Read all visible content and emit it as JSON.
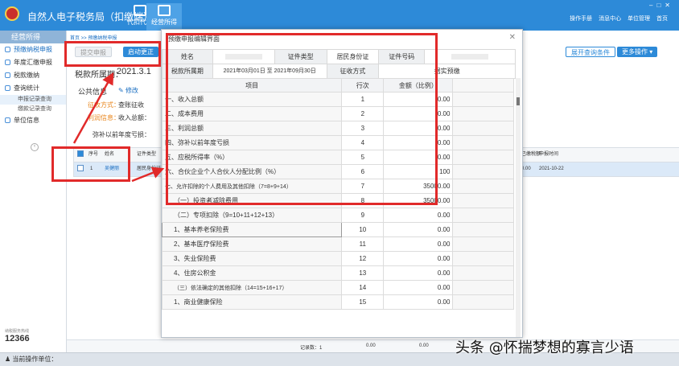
{
  "app": {
    "title": "自然人电子税务局（扣缴端）"
  },
  "topnav": [
    {
      "label": "代扣代缴"
    },
    {
      "label": "经营所得"
    }
  ],
  "toplinks": [
    "操作手册",
    "消息中心",
    "单位管理",
    "首页"
  ],
  "sidebar": {
    "header": "经营所得",
    "items": [
      {
        "label": "预缴纳税申报"
      },
      {
        "label": "年度汇缴申报"
      },
      {
        "label": "税款缴纳"
      },
      {
        "label": "查询统计"
      }
    ],
    "subitems": [
      {
        "label": "申报记录查询"
      },
      {
        "label": "缴款记录查询"
      }
    ],
    "unit_info": "单位信息",
    "logo_number": "12366",
    "logo_caption": "纳税服务热线"
  },
  "main": {
    "breadcrumb": "首页 >> 预缴纳税申报",
    "submit_button": "提交申报",
    "correct_button": "启动更正",
    "period_label": "税款所属期：",
    "period_value": "2021.3.1",
    "public_info": "公共信息",
    "edit_link": "修改",
    "collect_method_label": "征收方式：",
    "collect_method_value": "查账征收",
    "profit_label": "利润信息：",
    "profit_value": "收入总额：",
    "loss_label": "弥补以前年度亏损：",
    "expand_button": "展开查询条件",
    "more_button": "更多操作",
    "table": {
      "headers": [
        "序号",
        "姓名",
        "证件类型",
        "",
        "已缴税额",
        "申报时间"
      ],
      "row": {
        "index": "1",
        "name": "吴健丽",
        "id_type": "居民身份证",
        "tax_paid": "0.00",
        "time": "2021-10-22"
      }
    },
    "footer": {
      "record_count": "记录数：1",
      "v1": "0.00",
      "v2": "0.00"
    }
  },
  "statusbar": {
    "label": "当前操作单位："
  },
  "dialog": {
    "title": "预缴申报编辑界面",
    "info": {
      "name_label": "姓名",
      "id_type_label": "证件类型",
      "id_type_value": "居民身份证",
      "id_no_label": "证件号码",
      "period_label": "税款所属期",
      "period_value": "2021年03月01日 至 2021年09月30日",
      "method_label": "征收方式",
      "method_value": "据实预缴"
    },
    "headers": {
      "item": "项目",
      "row": "行次",
      "amount": "金额（比例）"
    },
    "rows": [
      {
        "name": "一、收入总额",
        "row": "1",
        "amount": "0.00"
      },
      {
        "name": "二、成本费用",
        "row": "2",
        "amount": "0.00"
      },
      {
        "name": "三、利润总额",
        "row": "3",
        "amount": "0.00"
      },
      {
        "name": "四、弥补以前年度亏损",
        "row": "4",
        "amount": "0.00"
      },
      {
        "name": "五、应税所得率（%）",
        "row": "5",
        "amount": "0.00"
      },
      {
        "name": "六、合伙企业个人合伙人分配比例（%）",
        "row": "6",
        "amount": "100"
      },
      {
        "name": "七、允许扣除的个人费用及其他扣除（7=8+9+14）",
        "row": "7",
        "amount": "35000.00"
      },
      {
        "name": "（一）投资者减除费用",
        "row": "8",
        "amount": "35000.00"
      },
      {
        "name": "（二）专项扣除（9=10+11+12+13）",
        "row": "9",
        "amount": "0.00"
      },
      {
        "name": "1、基本养老保险费",
        "row": "10",
        "amount": "0.00"
      },
      {
        "name": "2、基本医疗保险费",
        "row": "11",
        "amount": "0.00"
      },
      {
        "name": "3、失业保险费",
        "row": "12",
        "amount": "0.00"
      },
      {
        "name": "4、住房公积金",
        "row": "13",
        "amount": "0.00"
      },
      {
        "name": "（三）依法确定的其他扣除（14=15+16+17）",
        "row": "14",
        "amount": "0.00"
      },
      {
        "name": "1、商业健康保险",
        "row": "15",
        "amount": "0.00"
      }
    ]
  },
  "watermark": "头条 @怀揣梦想的寡言少语",
  "colors": {
    "header_blue": "#2d8ad8",
    "annotation_red": "#e12a2a",
    "orange": "#e8841a"
  }
}
